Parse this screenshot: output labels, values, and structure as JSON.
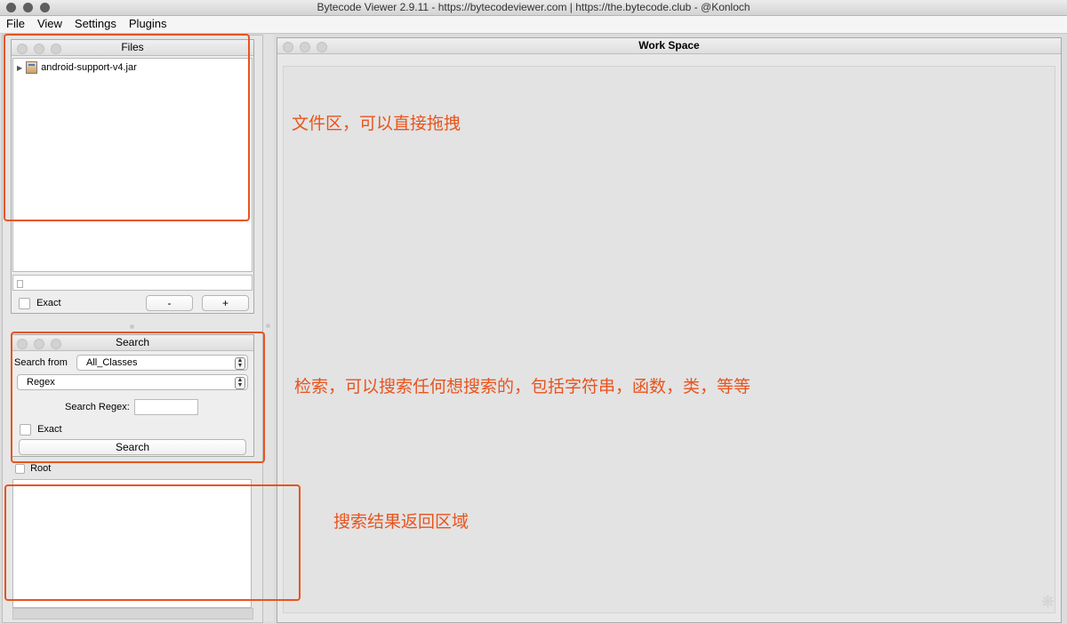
{
  "app": {
    "window_title": "Bytecode Viewer 2.9.11 - https://bytecodeviewer.com | https://the.bytecode.club - @Konloch"
  },
  "menu": [
    "File",
    "View",
    "Settings",
    "Plugins"
  ],
  "files_panel": {
    "title": "Files",
    "tree_item": "android-support-v4.jar",
    "filter_value": "",
    "exact_label": "Exact",
    "minus_label": "-",
    "plus_label": "+"
  },
  "search_panel": {
    "title": "Search",
    "search_from_label": "Search from",
    "search_from_value": "All_Classes",
    "mode_value": "Regex",
    "regex_label": "Search Regex:",
    "regex_value": "",
    "exact_label": "Exact",
    "search_button": "Search"
  },
  "results": {
    "root_label": "Root"
  },
  "workspace": {
    "title": "Work Space"
  },
  "annotations": {
    "files_note": "文件区，可以直接拖拽",
    "search_note": "检索，可以搜索任何想搜索的，包括字符串，函数，类，等等",
    "results_note": "搜索结果返回区域"
  },
  "colors": {
    "annotation": "#e8541e"
  }
}
